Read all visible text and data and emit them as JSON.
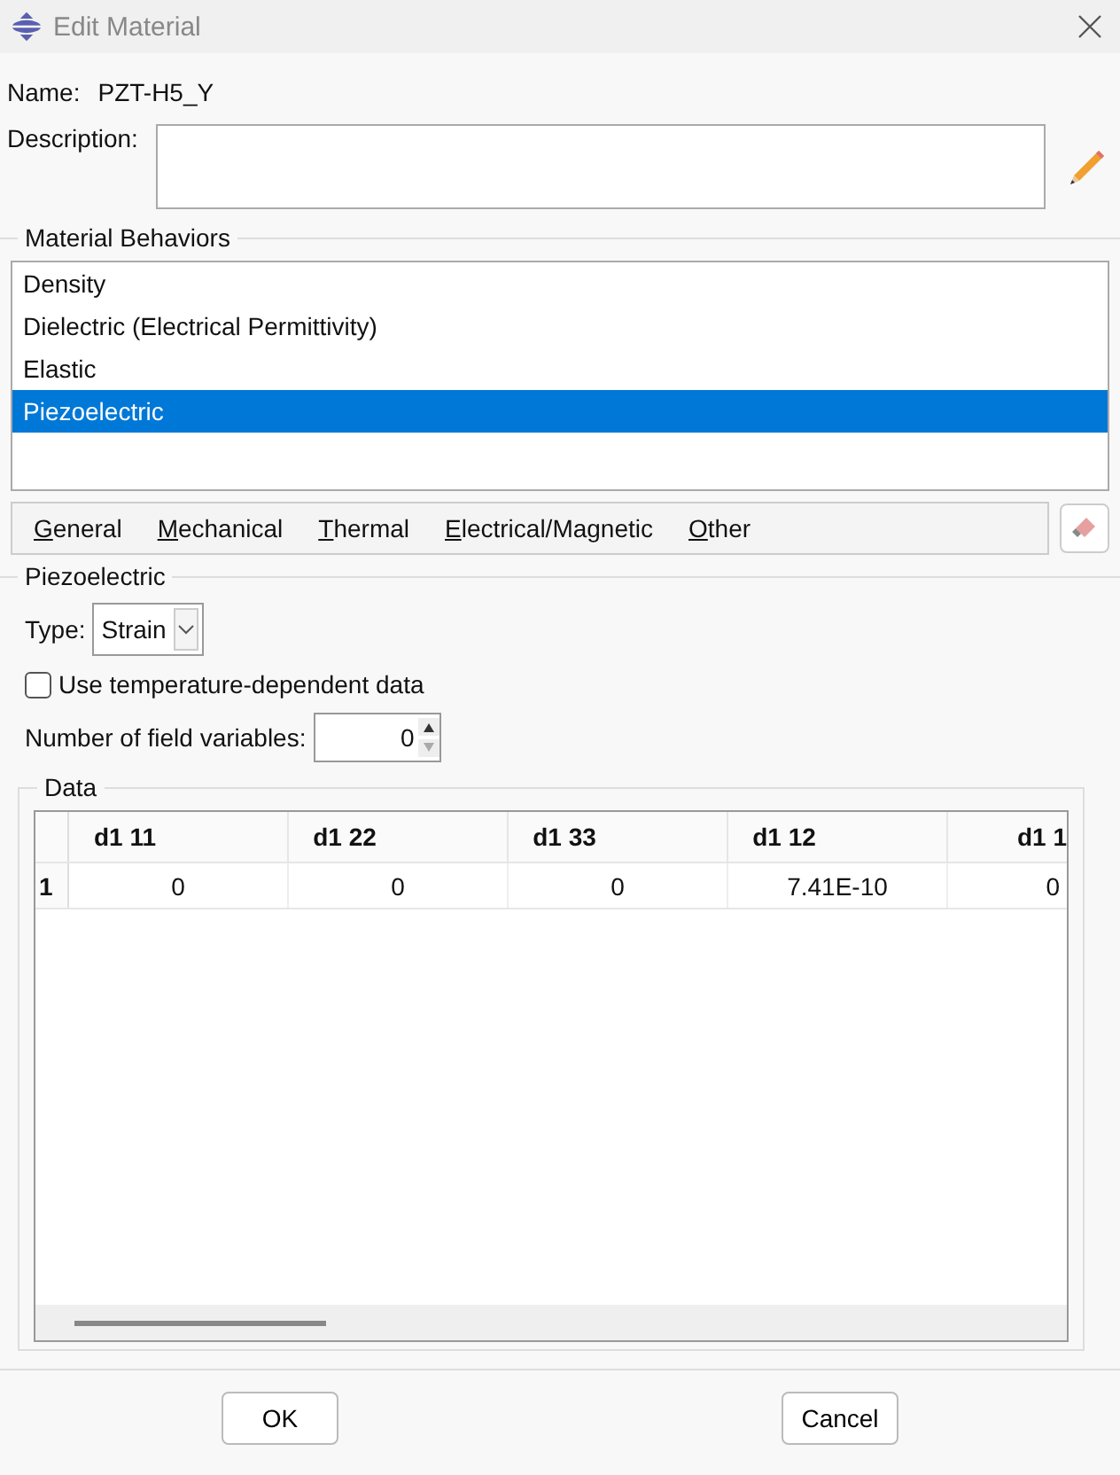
{
  "window": {
    "title": "Edit Material"
  },
  "name": {
    "label": "Name:",
    "value": "PZT-H5_Y"
  },
  "description": {
    "label": "Description:"
  },
  "material_behaviors": {
    "title": "Material Behaviors",
    "items": [
      {
        "label": "Density",
        "selected": false
      },
      {
        "label": "Dielectric (Electrical Permittivity)",
        "selected": false
      },
      {
        "label": "Elastic",
        "selected": false
      },
      {
        "label": "Piezoelectric",
        "selected": true
      }
    ]
  },
  "menus": [
    "General",
    "Mechanical",
    "Thermal",
    "Electrical/Magnetic",
    "Other"
  ],
  "section": {
    "title": "Piezoelectric",
    "type": {
      "label": "Type:",
      "value": "Strain"
    },
    "temperature_dependent": {
      "label": "Use temperature-dependent data",
      "checked": false
    },
    "field_variables": {
      "label": "Number of field variables:",
      "value": "0"
    },
    "data": {
      "title": "Data",
      "columns": [
        "d1 11",
        "d1 22",
        "d1 33",
        "d1 12",
        "d1 1"
      ],
      "rows": [
        {
          "index": "1",
          "cells": [
            "0",
            "0",
            "0",
            "7.41E-10",
            "0"
          ]
        }
      ]
    }
  },
  "buttons": [
    "OK",
    "Cancel"
  ]
}
